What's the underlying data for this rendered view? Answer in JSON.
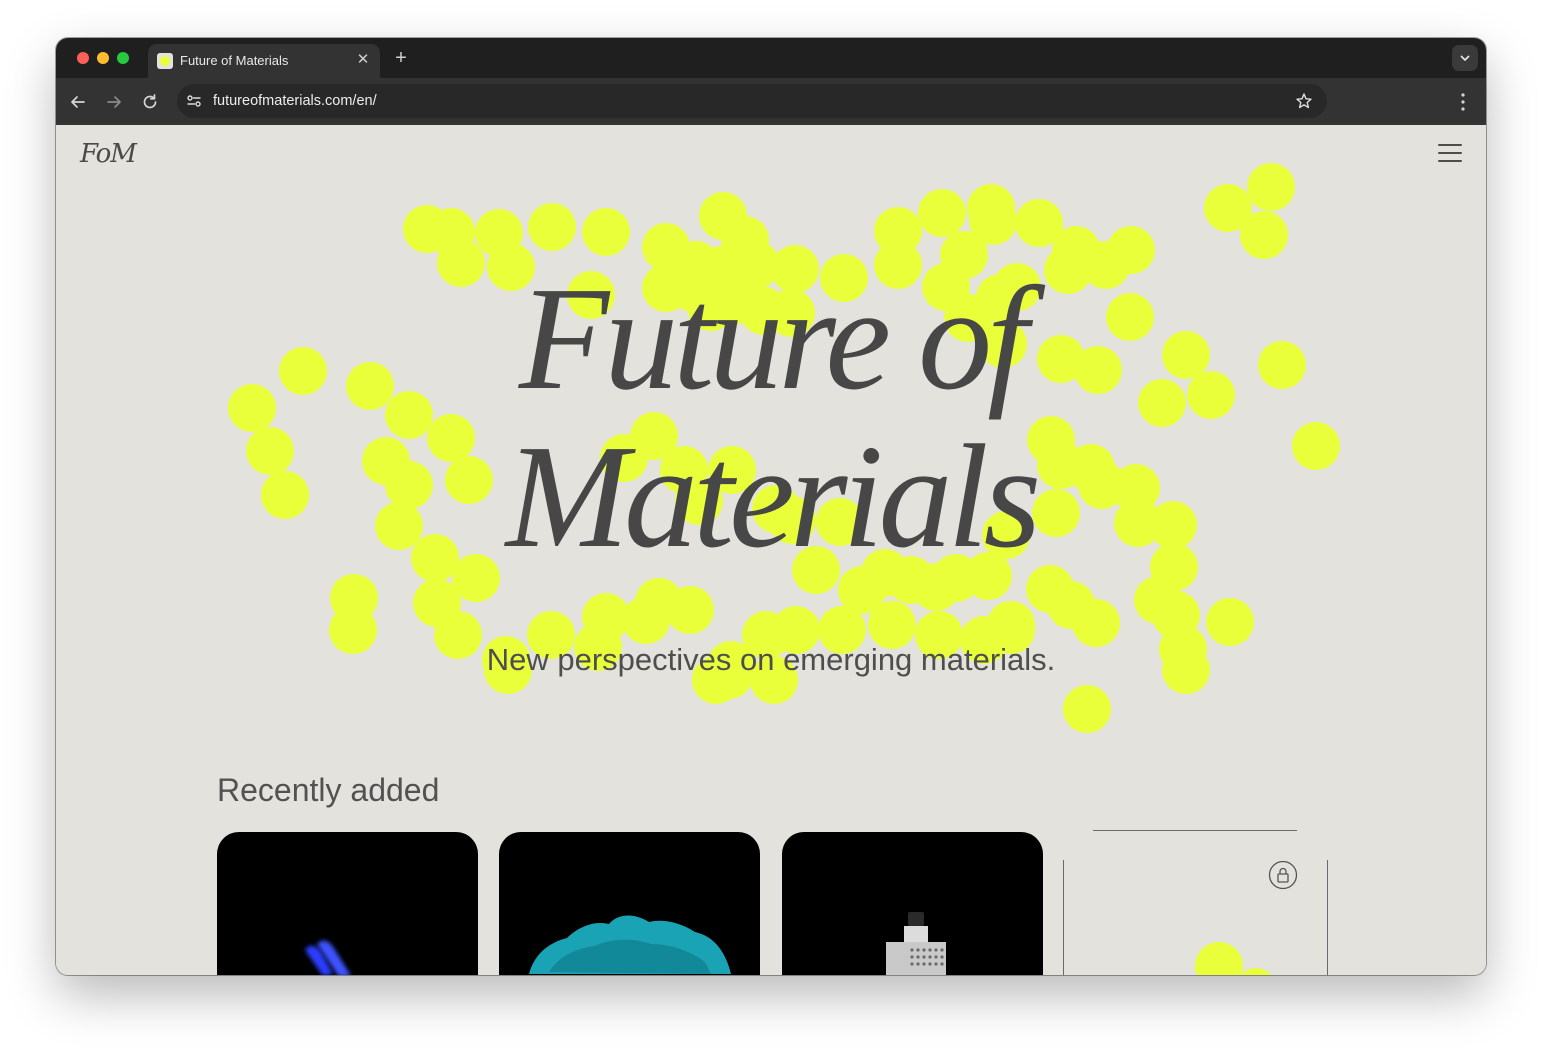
{
  "browser": {
    "tab": {
      "title": "Future of Materials"
    },
    "address_bar": {
      "url": "futureofmaterials.com/en/"
    }
  },
  "colors": {
    "accent": "#e8ff3a",
    "background": "#e3e2dd",
    "text": "#474747"
  },
  "site": {
    "logo": "FoM",
    "hero": {
      "title_line1": "Future of",
      "title_line2": "Materials",
      "subtitle": "New perspectives on emerging materials."
    },
    "recently_added": {
      "heading": "Recently added",
      "cards": [
        {
          "image": "blue-light-streak",
          "locked": false
        },
        {
          "image": "teal-crystal-mass",
          "locked": false
        },
        {
          "image": "metal-bottle-device",
          "locked": false
        },
        {
          "image": "yellow-dots",
          "locked": true
        }
      ]
    }
  },
  "icons": [
    "back-arrow-icon",
    "forward-arrow-icon",
    "reload-icon",
    "site-info-icon",
    "star-icon",
    "kebab-menu-icon",
    "hamburger-menu-icon",
    "lock-icon",
    "chevron-down-icon",
    "close-icon",
    "plus-icon"
  ]
}
